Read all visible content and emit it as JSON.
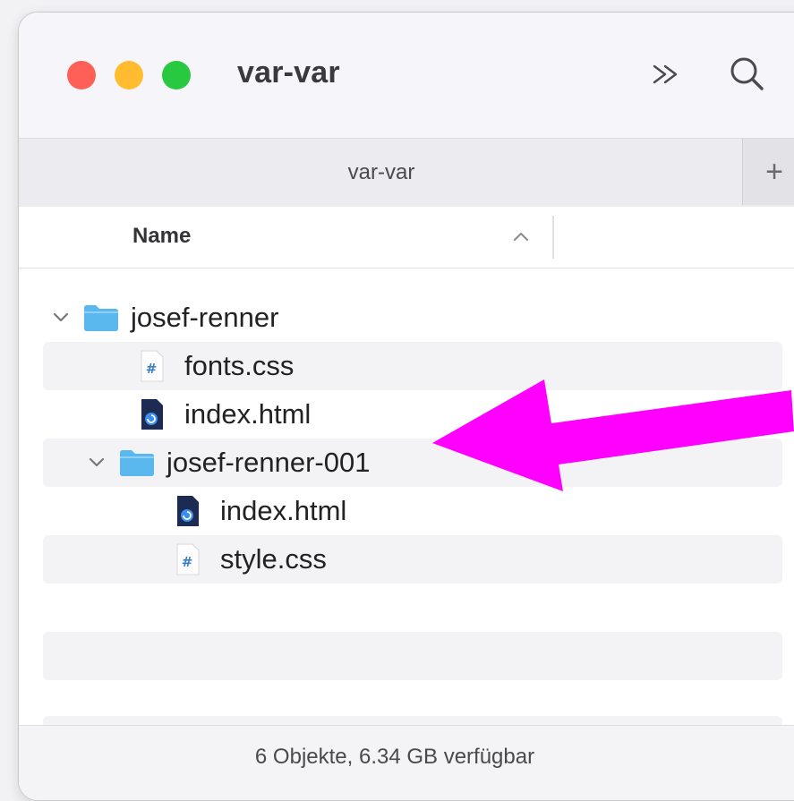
{
  "window": {
    "title": "var-var"
  },
  "toolbar": {
    "more_icon": "chevron-double-right-icon",
    "search_icon": "search-icon"
  },
  "tabs": [
    {
      "label": "var-var"
    }
  ],
  "new_tab_label": "+",
  "columns": {
    "name_label": "Name",
    "sort": "ascending"
  },
  "rows": [
    {
      "label": "josef-renner",
      "type": "folder",
      "expanded": true,
      "indent": 0
    },
    {
      "label": "fonts.css",
      "type": "css",
      "indent": 1
    },
    {
      "label": "index.html",
      "type": "html",
      "indent": 1
    },
    {
      "label": "josef-renner-001",
      "type": "folder",
      "expanded": true,
      "indent": 1
    },
    {
      "label": "index.html",
      "type": "html",
      "indent": 2
    },
    {
      "label": "style.css",
      "type": "css",
      "indent": 2
    }
  ],
  "status": {
    "text": "6 Objekte, 6.34 GB verfügbar"
  },
  "colors": {
    "traffic_red": "#fe5f57",
    "traffic_yellow": "#febc2e",
    "traffic_green": "#28c840",
    "folder": "#5bb8ef",
    "annotation_arrow": "#ff00ff"
  }
}
